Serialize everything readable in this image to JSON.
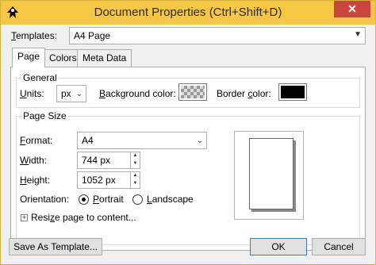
{
  "window": {
    "title": "Document Properties (Ctrl+Shift+D)",
    "close_glyph": "✕",
    "accent_color": "#f6c744",
    "close_color": "#c7463d"
  },
  "templates": {
    "label_prefix": "T",
    "label_rest": "emplates:",
    "selected": "A4 Page"
  },
  "tabs": [
    {
      "label": "Page",
      "active": true
    },
    {
      "label": "Colors",
      "active": false
    },
    {
      "label": "Meta Data",
      "active": false
    }
  ],
  "general": {
    "title": "General",
    "units_label_prefix": "U",
    "units_label_rest": "nits:",
    "units_value": "px",
    "background_label_prefix": "B",
    "background_label_rest": "ackground color:",
    "border_label_pre": "Border ",
    "border_label_u": "c",
    "border_label_post": "olor:",
    "border_color": "#000000"
  },
  "page_size": {
    "title": "Page Size",
    "format_label_prefix": "F",
    "format_label_rest": "ormat:",
    "format_value": "A4",
    "width_label_prefix": "W",
    "width_label_rest": "idth:",
    "width_value": "744 px",
    "height_label_prefix": "H",
    "height_label_rest": "eight:",
    "height_value": "1052 px",
    "orientation_label": "Orientation:",
    "portrait_label_prefix": "P",
    "portrait_label_rest": "ortrait",
    "landscape_label_prefix": "L",
    "landscape_label_rest": "andscape",
    "orientation_selected": "Portrait",
    "resize_label_pre": "Resi",
    "resize_label_u": "z",
    "resize_label_post": "e page to content..."
  },
  "buttons": {
    "save_template": "Save As Template...",
    "ok": "OK",
    "cancel": "Cancel"
  },
  "icons": {
    "app": "inkscape-icon",
    "dropdown": "chevron-down-icon",
    "expander": "plus-expander-icon"
  }
}
